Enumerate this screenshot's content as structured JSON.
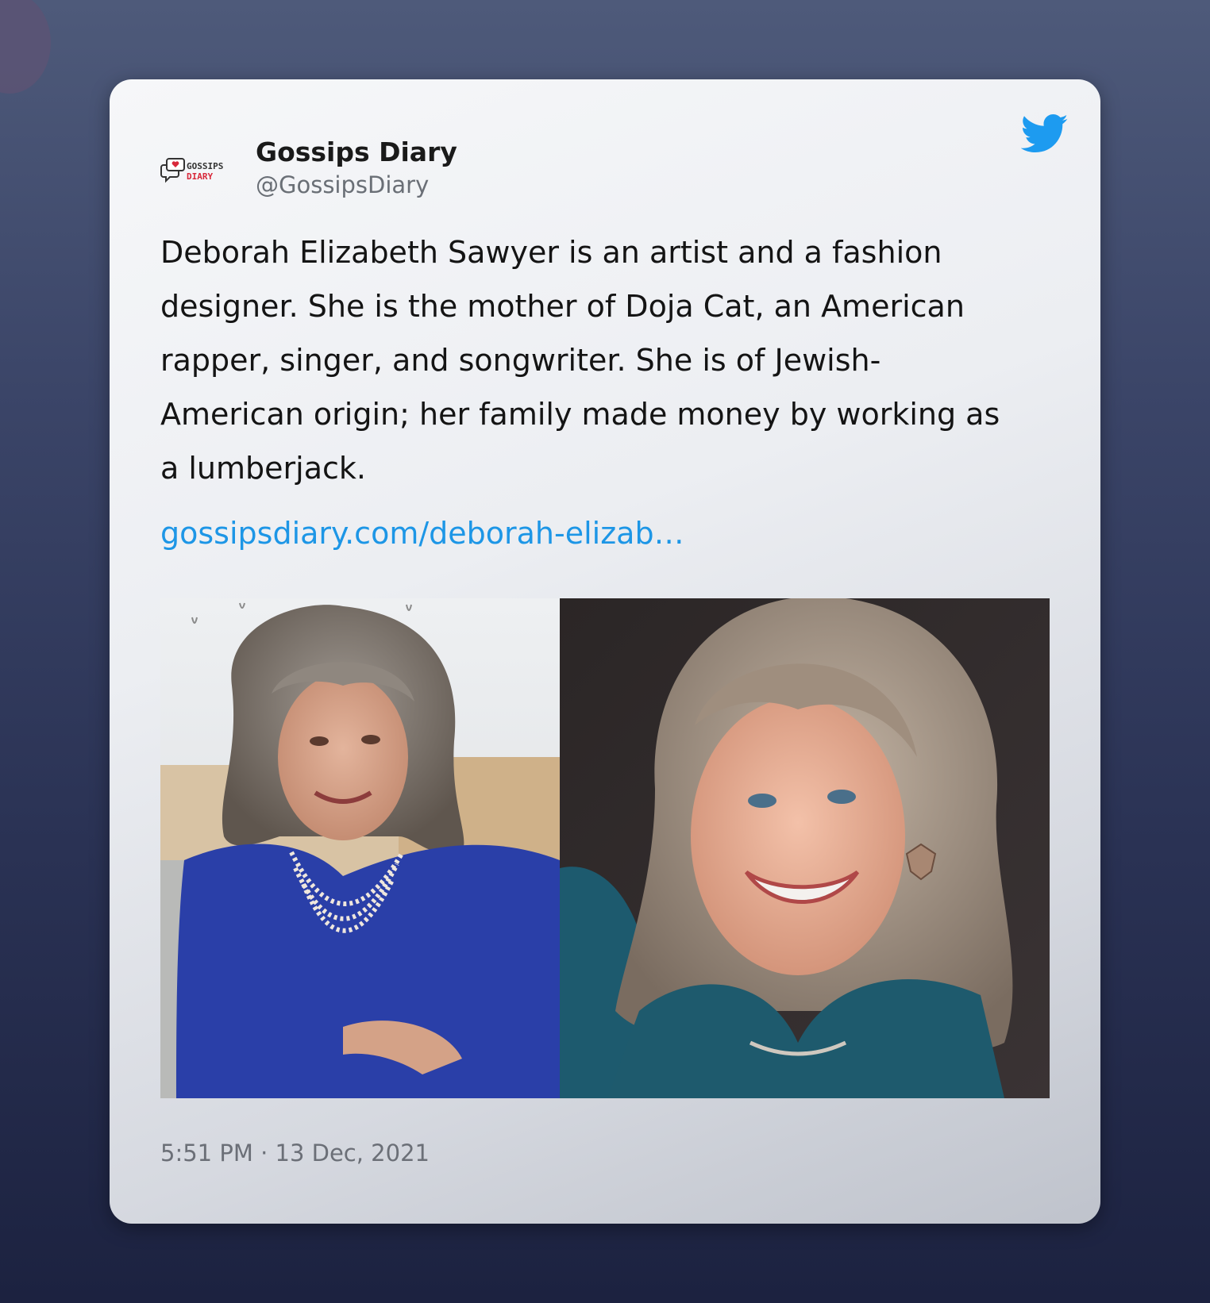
{
  "author": {
    "name": "Gossips Diary",
    "handle": "@GossipsDiary",
    "avatar_logo": {
      "line1": "GOSSIPS",
      "line2": "DIARY"
    }
  },
  "tweet": {
    "text": "Deborah Elizabeth Sawyer is an artist and a fashion\ndesigner.  She is the mother of Doja Cat, an American\nrapper, singer, and songwriter. She is of Jewish-\nAmerican origin; her family made money by working as\na lumberjack.",
    "link": "gossipsdiary.com/deborah-elizab…",
    "timestamp": "5:51 PM · 13 Dec, 2021"
  },
  "icons": {
    "brand": "twitter-bird-icon"
  },
  "colors": {
    "link": "#1d96e6",
    "twitter_blue": "#1d9bf0",
    "logo_red": "#d8283a"
  }
}
